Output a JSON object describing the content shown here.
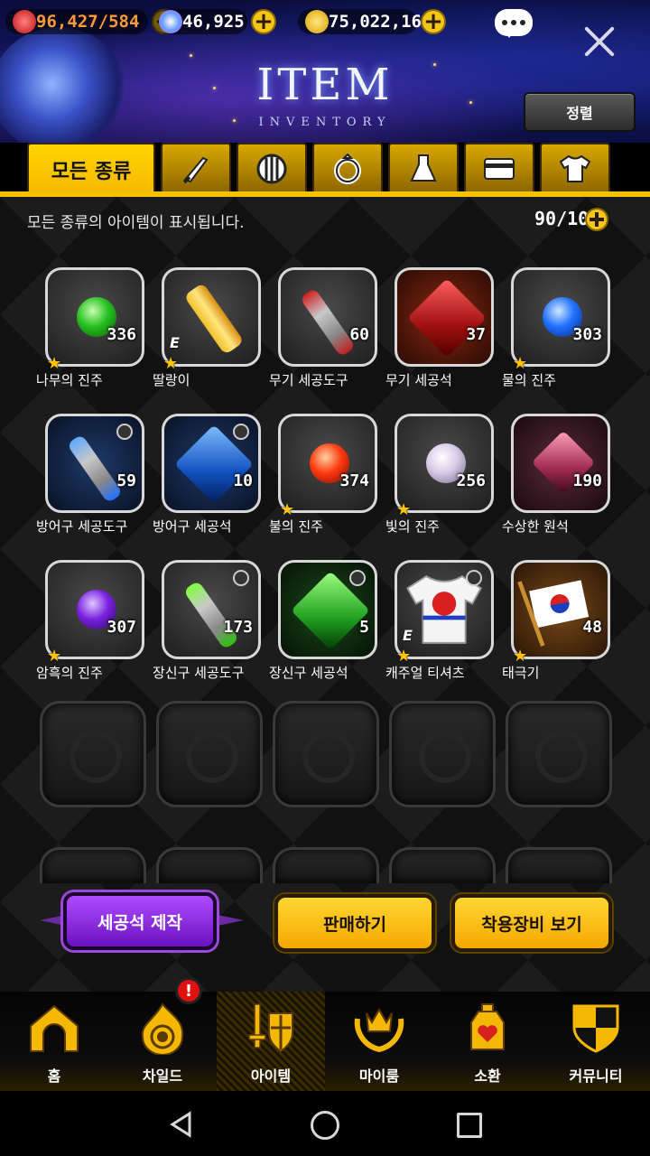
{
  "currency": {
    "stamina": "96,427/584",
    "gems": "46,925",
    "gold": "75,022,164"
  },
  "header": {
    "title": "ITEM",
    "subtitle": "INVENTORY",
    "sort_label": "정렬"
  },
  "tabs": {
    "all_label": "모든 종류",
    "icons": [
      "sword-icon",
      "shield-icon",
      "ring-icon",
      "potion-icon",
      "card-icon",
      "shirt-icon"
    ]
  },
  "inventory": {
    "description": "모든 종류의 아이템이 표시됩니다.",
    "count": "90/100"
  },
  "items": [
    {
      "name": "나무의 진주",
      "qty": "336"
    },
    {
      "name": "딸랑이",
      "qty": ""
    },
    {
      "name": "무기 세공도구",
      "qty": "60"
    },
    {
      "name": "무기 세공석",
      "qty": "37"
    },
    {
      "name": "물의 진주",
      "qty": "303"
    },
    {
      "name": "방어구 세공도구",
      "qty": "59"
    },
    {
      "name": "방어구 세공석",
      "qty": "10"
    },
    {
      "name": "불의 진주",
      "qty": "374"
    },
    {
      "name": "빛의 진주",
      "qty": "256"
    },
    {
      "name": "수상한 원석",
      "qty": "190"
    },
    {
      "name": "암흑의 진주",
      "qty": "307"
    },
    {
      "name": "장신구 세공도구",
      "qty": "173"
    },
    {
      "name": "장신구 세공석",
      "qty": "5"
    },
    {
      "name": "캐주얼 티셔츠",
      "qty": ""
    },
    {
      "name": "태극기",
      "qty": "48"
    }
  ],
  "actions": {
    "gem_make": "세공석 제작",
    "sell": "판매하기",
    "view_equip": "착용장비 보기"
  },
  "nav": {
    "home": "홈",
    "child": "차일드",
    "item": "아이템",
    "myroom": "마이룸",
    "summon": "소환",
    "community": "커뮤니티",
    "alert": "!"
  },
  "colors": {
    "accent_gold": "#f5c000",
    "purple_button": "#8a2ee0"
  }
}
